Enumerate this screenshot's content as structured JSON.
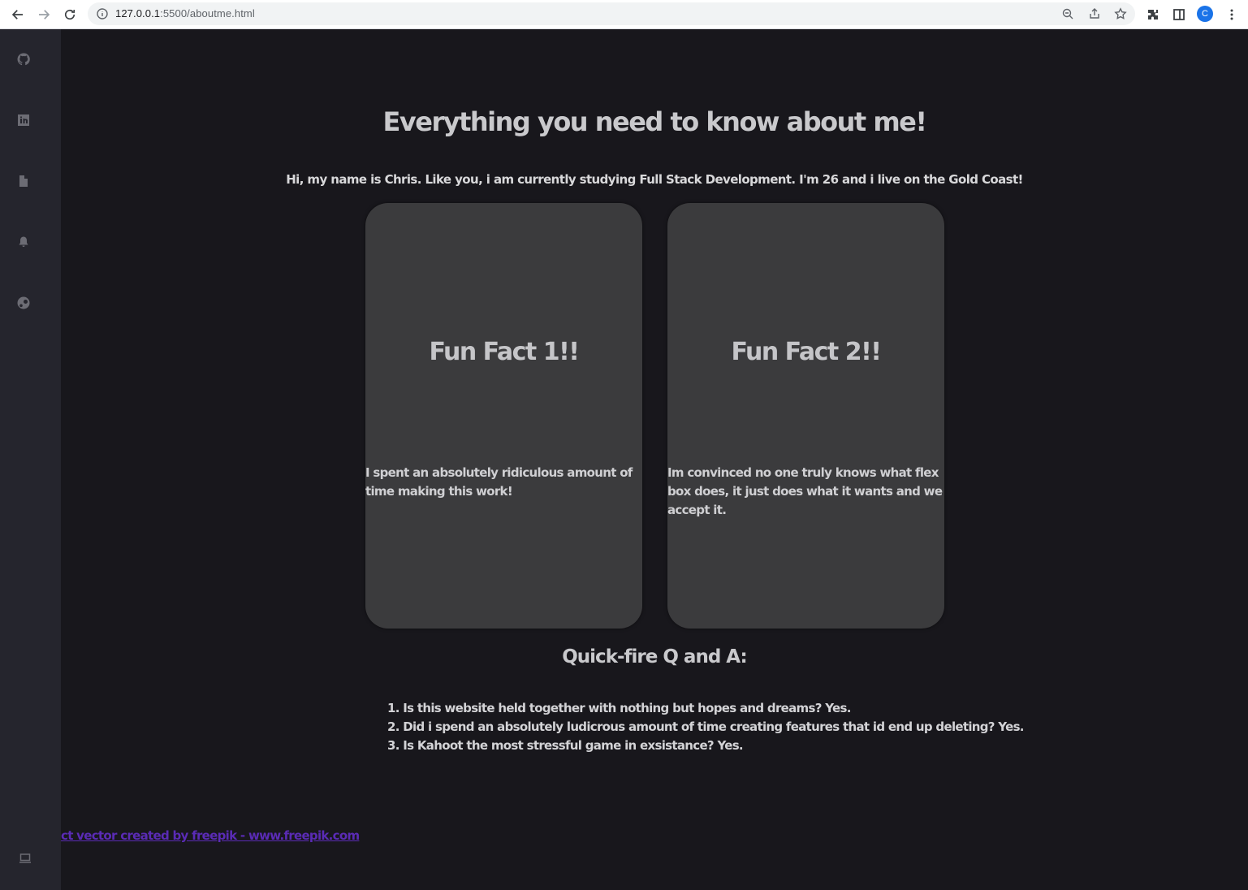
{
  "browser": {
    "url_host": "127.0.0.1",
    "url_path": ":5500/aboutme.html",
    "profile_initial": "C"
  },
  "sidebar": {
    "items": [
      {
        "icon": "github-icon"
      },
      {
        "icon": "linkedin-icon"
      },
      {
        "icon": "document-icon"
      },
      {
        "icon": "bell-icon"
      },
      {
        "icon": "steam-icon"
      }
    ],
    "bottom_icon": "laptop-icon"
  },
  "main": {
    "headline": "Everything you need to know about me!",
    "intro": "Hi, my name is Chris. Like you, i am currently studying Full Stack Development. I'm 26 and i live on the Gold Coast!",
    "cards": [
      {
        "title": "Fun Fact 1!!",
        "text": "I spent an absolutely ridiculous amount of time making this work!"
      },
      {
        "title": "Fun Fact 2!!",
        "text": "Im convinced no one truly knows what flex box does, it just does what it wants and we accept it."
      }
    ],
    "qa_heading": "Quick-fire Q and A:",
    "qa_items": [
      "1. Is this website held together with nothing but hopes and dreams? Yes.",
      "2. Did i spend an absolutely ludicrous amount of time creating features that id end up deleting? Yes.",
      "3. Is Kahoot the most stressful game in exsistance? Yes."
    ],
    "credit_link": "ct vector created by freepik - www.freepik.com"
  },
  "colors": {
    "background": "#18171c",
    "sidebar": "#25252d",
    "card": "#3b3b3d",
    "link": "#5a2bb5"
  }
}
